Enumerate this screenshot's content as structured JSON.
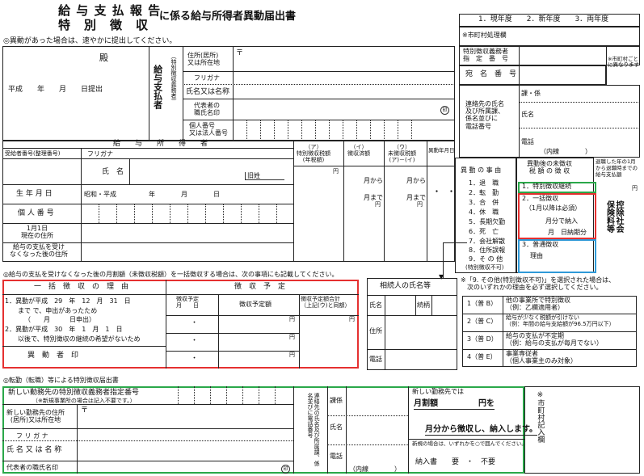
{
  "header": {
    "title_a": "給 与 支 払 報 告",
    "title_b": "特　別　徴　収",
    "title_rest": "に係る給与所得者異動届出書",
    "note_top": "◎異動があった場合は、速やかに提出してください。",
    "years": "1．現年度　　2．新年度　　3．両年度",
    "city_stamp": "※市町村処理欄"
  },
  "addressee": {
    "dono": "殿",
    "date": "平成　　年　　月　　日提出"
  },
  "payer": {
    "side_label": "給与支払者",
    "side_sub": "（特別徴収義務者）",
    "addr_label": "住所(居所)\n又は所在地",
    "postal": "〒",
    "furigana": "フリガナ",
    "name_label": "氏名又は名称",
    "rep_label": "代表者の\n職氏名印",
    "seal": "印",
    "number_label": "個人番号\n又は法人番号",
    "designation_label": "特別徴収義務者\n指　定　番　号",
    "city_note": "※市町村ごと\nに異なります",
    "addressee_label": "宛　名　番　号",
    "contact_label": "連絡先の氏名\n及び所属課、\n係名並びに\n電話番号",
    "contact_ka": "課・係",
    "contact_name": "氏名",
    "contact_tel": "電話",
    "contact_ext": "（内線　　　　）"
  },
  "employee": {
    "section_label": "給　　与　　所　　得　　者",
    "recv_no": "受給者番号(整理番号)",
    "furigana": "フリガナ",
    "name_label": "氏　名",
    "old_name": "旧姓",
    "dob_label": "生 年 月 日",
    "dob_value": "昭和・平成　　　　　年　　　　月　　　　日",
    "personal_no": "個 人 番 号",
    "jan1_addr": "1月1日\n現在の住所",
    "after_addr": "給与の支払を受け\nなくなった後の住所",
    "col_a": "（ア）\n特別徴収税額\n(年税額)",
    "col_i": "（イ）\n徴収済額",
    "col_u": "（ウ）\n未徴収税額\n(ア)－(イ)",
    "col_date": "異動年月日",
    "yen": "円",
    "month_from": "月から",
    "month_to": "月まで",
    "dots": "・　・",
    "reason_head": "異 動 の 事 由",
    "reasons": [
      "1．退　職",
      "2．転　勤",
      "3．合　併",
      "4．休　職",
      "5．長期欠勤",
      "6．死　亡",
      "7．会社解散",
      "8．住所誤報",
      "9．そ の 他"
    ],
    "reason_other": "(特別徴収不可)",
    "method_head": "異動後の未徴収\n税 額 の 徴 収",
    "method_1": "1．特別徴収継続",
    "method_2": "2．一括徴収",
    "method_2_note": "（1月以降は必須）",
    "method_2_pay": "月分で納入",
    "method_2_due": "月　日納期分",
    "method_3": "3．普通徴収",
    "method_3_reason": "理由",
    "ex_note": "退職した年の1月から退職時までの給与支払額",
    "ex_yen": "円",
    "tokubetsu_vertical": "控除社会\n保険料等"
  },
  "lump": {
    "note": "◎給与の支払を受けなくなった後の月割額（未徴収税額）を一括徴収する場合は、次の事項にも記載してください。",
    "reason_head": "一　括　徴　収　の　理　由",
    "r1": "1．異動が平成　29　年　12　月　31　日",
    "r1b": "　　まで で、申出があったため",
    "r1c": "（　　月　　　日申出）",
    "r2": "2．異動が平成　30　年　1　月　1　日",
    "r2b": "　　以後で、特別徴収の継続の希望がないため",
    "seal_label": "異　動　者　印",
    "plan_head": "徴　収　予　定",
    "plan_month": "徴収予定\n月　　日",
    "plan_amount": "徴収予定額",
    "plan_total": "徴収予定額合計\n（上記(ウ)と同額）",
    "yen": "円"
  },
  "heir": {
    "head": "相続人の氏名等",
    "name": "氏名",
    "relation": "続柄",
    "address": "住所",
    "tel": "電話"
  },
  "ordinary": {
    "note": "※「9. その他(特別徴収不可)」を選択された場合は、\n　次のいずれかの理由を必ず選択してください。",
    "options": [
      {
        "code": "1（普 B）",
        "text": "他の事業所で特別徴収\n（例：乙欄適用者）"
      },
      {
        "code": "2（普 C）",
        "text": "給与が少なく税額が引けない\n（例：年間の給与支給額が96.5万円以下）"
      },
      {
        "code": "3（普 D）",
        "text": "給与の支払が不定期\n（例：給与の支払が毎月でない）"
      },
      {
        "code": "4（普 E）",
        "text": "事業専従者\n（個人事業主のみ対象）"
      }
    ]
  },
  "transfer": {
    "note": "◎転勤（転職）等による特別徴収届出書",
    "new_designation": "新しい勤務先の特別徴収義務者指定番号",
    "new_designation_sub": "（※新規事業所の場合は記入不要です。）",
    "new_addr": "新しい勤務先の住所\n(居所)又は所在地",
    "postal": "〒",
    "furigana": "フ リ ガ ナ",
    "name_label": "氏 名 又 は 名 称",
    "rep_label": "代表者の職氏名印",
    "seal": "印",
    "contact_side": "連絡先の氏名及び所属課、係名並びに電話番号",
    "ka": "課係",
    "name": "氏名",
    "tel": "電話",
    "ext": "（内線　　　　）",
    "right_head": "新しい勤務先では",
    "right_line1": "月割額　　　　　円を",
    "right_line2": "月分から徴収し、納入します。",
    "right_note": "新規の場合は、いずれかを○で囲んでください。",
    "right_bottom": "納入書　　要　・　不要",
    "city_col": "※市町村記入欄"
  },
  "colors": {
    "red": "#e53030",
    "green": "#2aa84a",
    "blue": "#2f9ad8"
  }
}
